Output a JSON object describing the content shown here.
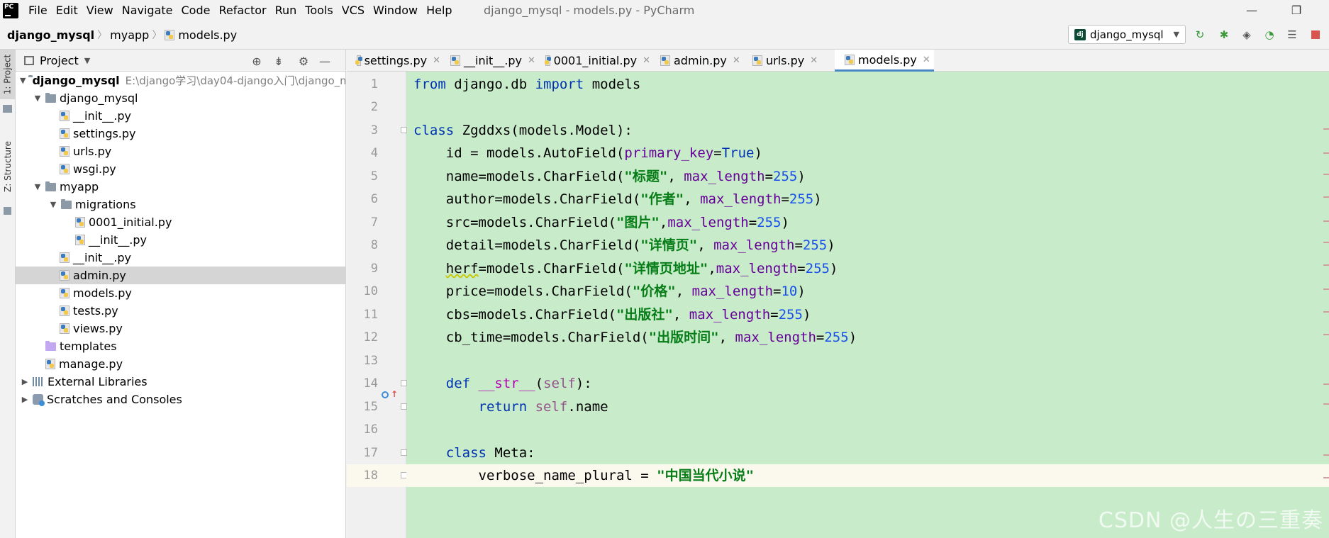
{
  "menubar": {
    "items": [
      "File",
      "Edit",
      "View",
      "Navigate",
      "Code",
      "Refactor",
      "Run",
      "Tools",
      "VCS",
      "Window",
      "Help"
    ],
    "window_title": "django_mysql - models.py - PyCharm"
  },
  "navbar": {
    "breadcrumb": [
      "django_mysql",
      "myapp",
      "models.py"
    ],
    "run_config": "django_mysql"
  },
  "left_strip": {
    "project_tab": "1: Project",
    "structure_tab": "Z: Structure"
  },
  "project_panel": {
    "title": "Project",
    "tree": [
      {
        "label": "django_mysql",
        "hint": "E:\\django学习\\day04-django入门\\django_m",
        "kind": "folder-root",
        "expanded": true
      },
      {
        "label": "django_mysql",
        "kind": "folder",
        "expanded": true
      },
      {
        "label": "__init__.py",
        "kind": "py"
      },
      {
        "label": "settings.py",
        "kind": "py"
      },
      {
        "label": "urls.py",
        "kind": "py"
      },
      {
        "label": "wsgi.py",
        "kind": "py"
      },
      {
        "label": "myapp",
        "kind": "folder",
        "expanded": true
      },
      {
        "label": "migrations",
        "kind": "folder",
        "expanded": true
      },
      {
        "label": "0001_initial.py",
        "kind": "py"
      },
      {
        "label": "__init__.py",
        "kind": "py"
      },
      {
        "label": "__init__.py",
        "kind": "py"
      },
      {
        "label": "admin.py",
        "kind": "py",
        "selected": true
      },
      {
        "label": "models.py",
        "kind": "py"
      },
      {
        "label": "tests.py",
        "kind": "py"
      },
      {
        "label": "views.py",
        "kind": "py"
      },
      {
        "label": "templates",
        "kind": "folder-purple"
      },
      {
        "label": "manage.py",
        "kind": "py"
      },
      {
        "label": "External Libraries",
        "kind": "lib",
        "expanded": false
      },
      {
        "label": "Scratches and Consoles",
        "kind": "scratch",
        "expanded": false
      }
    ]
  },
  "tabs": [
    {
      "label": "settings.py",
      "active": false
    },
    {
      "label": "__init__.py",
      "active": false
    },
    {
      "label": "0001_initial.py",
      "active": false
    },
    {
      "label": "admin.py",
      "active": false
    },
    {
      "label": "urls.py",
      "active": false
    },
    {
      "label": "models.py",
      "active": true
    }
  ],
  "editor": {
    "line_numbers": [
      "1",
      "2",
      "3",
      "4",
      "5",
      "6",
      "7",
      "8",
      "9",
      "10",
      "11",
      "12",
      "13",
      "14",
      "15",
      "16",
      "17",
      "18"
    ],
    "code": {
      "l1_from": "from",
      "l1_mod": " django.db ",
      "l1_import": "import",
      "l1_rest": " models",
      "l3_class": "class",
      "l3_rest": " Zgddxs(models.Model):",
      "l4_a": "    id = models.AutoField(",
      "l4_k": "primary_key",
      "l4_eq": "=",
      "l4_v": "True",
      "l4_e": ")",
      "l5_a": "    name=models.CharField(",
      "l5_s": "\"标题\"",
      "l5_c": ", ",
      "l5_k": "max_length",
      "l5_eq": "=",
      "l5_n": "255",
      "l5_e": ")",
      "l6_a": "    author=models.CharField(",
      "l6_s": "\"作者\"",
      "l6_c": ", ",
      "l6_k": "max_length",
      "l6_eq": "=",
      "l6_n": "255",
      "l6_e": ")",
      "l7_a": "    src=models.CharField(",
      "l7_s": "\"图片\"",
      "l7_c": ",",
      "l7_k": "max_length",
      "l7_eq": "=",
      "l7_n": "255",
      "l7_e": ")",
      "l8_a": "    detail=models.CharField(",
      "l8_s": "\"详情页\"",
      "l8_c": ", ",
      "l8_k": "max_length",
      "l8_eq": "=",
      "l8_n": "255",
      "l8_e": ")",
      "l9_a": "    ",
      "l9_w": "herf",
      "l9_b": "=models.CharField(",
      "l9_s": "\"详情页地址\"",
      "l9_c": ",",
      "l9_k": "max_length",
      "l9_eq": "=",
      "l9_n": "255",
      "l9_e": ")",
      "l10_a": "    price=models.CharField(",
      "l10_s": "\"价格\"",
      "l10_c": ", ",
      "l10_k": "max_length",
      "l10_eq": "=",
      "l10_n": "10",
      "l10_e": ")",
      "l11_a": "    cbs=models.CharField(",
      "l11_s": "\"出版社\"",
      "l11_c": ", ",
      "l11_k": "max_length",
      "l11_eq": "=",
      "l11_n": "255",
      "l11_e": ")",
      "l12_a": "    cb_time=models.CharField(",
      "l12_s": "\"出版时间\"",
      "l12_c": ", ",
      "l12_k": "max_length",
      "l12_eq": "=",
      "l12_n": "255",
      "l12_e": ")",
      "l14_ind": "    ",
      "l14_def": "def",
      "l14_sp": " ",
      "l14_name": "__str__",
      "l14_p": "(",
      "l14_self": "self",
      "l14_e": "):",
      "l15_ind": "        ",
      "l15_ret": "return",
      "l15_sp": " ",
      "l15_self": "self",
      "l15_rest": ".name",
      "l17_ind": "    ",
      "l17_class": "class",
      "l17_rest": " Meta:",
      "l18_a": "        verbose_name_plural = ",
      "l18_s": "\"中国当代小说\""
    }
  },
  "watermark": "CSDN @人生の三重奏"
}
